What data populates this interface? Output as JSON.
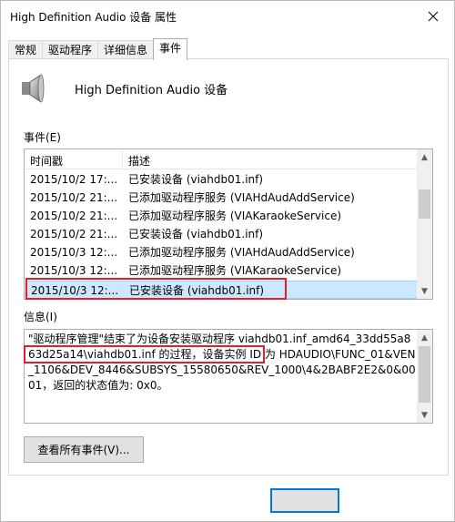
{
  "window": {
    "title": "High Definition Audio 设备 属性"
  },
  "tabs": [
    {
      "label": "常规",
      "active": false
    },
    {
      "label": "驱动程序",
      "active": false
    },
    {
      "label": "详细信息",
      "active": false
    },
    {
      "label": "事件",
      "active": true
    }
  ],
  "device": {
    "name": "High Definition Audio 设备",
    "icon": "speaker-icon"
  },
  "events": {
    "label": "事件(E)",
    "columns": {
      "time": "时间戳",
      "desc": "描述"
    },
    "rows": [
      {
        "time": "2015/10/2 17:...",
        "desc": "已安装设备 (viahdb01.inf)"
      },
      {
        "time": "2015/10/2 21:...",
        "desc": "已添加驱动程序服务 (VIAHdAudAddService)"
      },
      {
        "time": "2015/10/2 21:...",
        "desc": "已添加驱动程序服务 (VIAKaraokeService)"
      },
      {
        "time": "2015/10/2 21:...",
        "desc": "已安装设备 (viahdb01.inf)"
      },
      {
        "time": "2015/10/3 12:...",
        "desc": "已添加驱动程序服务 (VIAHdAudAddService)"
      },
      {
        "time": "2015/10/3 12:...",
        "desc": "已添加驱动程序服务 (VIAKaraokeService)"
      },
      {
        "time": "2015/10/3 12:...",
        "desc": "已安装设备 (viahdb01.inf)",
        "selected": true
      }
    ]
  },
  "info": {
    "label": "信息(I)",
    "text": "\"驱动程序管理\"结束了为设备安装驱动程序 viahdb01.inf_amd64_33dd55a863d25a14\\viahdb01.inf 的过程，设备实例 ID 为 HDAUDIO\\FUNC_01&VEN_1106&DEV_8446&SUBSYS_15580650&REV_1000\\4&2BABF2E2&0&0001，返回的状态值为: 0x0。"
  },
  "buttons": {
    "view_all": "查看所有事件(V)..."
  },
  "colors": {
    "highlight": "#e0202a",
    "selection": "#cce8ff",
    "ok_border": "#0078d7"
  }
}
